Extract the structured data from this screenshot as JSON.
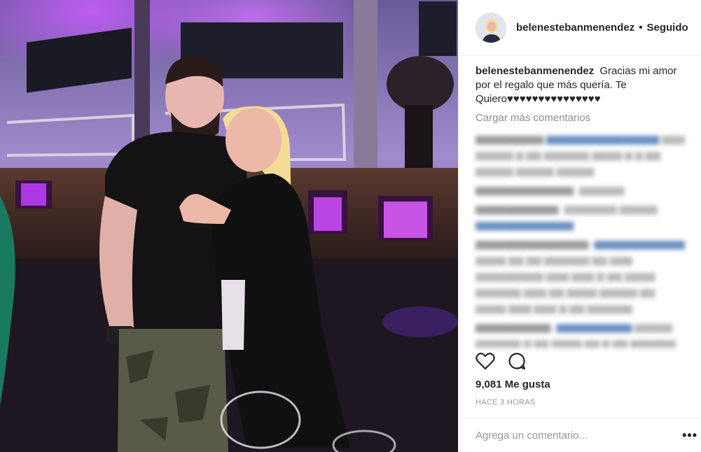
{
  "header": {
    "username": "belenestebanmenendez",
    "separator": "•",
    "follow_status": "Seguido"
  },
  "caption": {
    "username": "belenestebanmenendez",
    "text": "Gracias mi amor por el regalo que más quería. Te Quiero♥♥♥♥♥♥♥♥♥♥♥♥♥♥♥"
  },
  "comments": {
    "load_more": "Cargar más comentarios"
  },
  "actions": {
    "like_icon": "heart-icon",
    "comment_icon": "comment-icon"
  },
  "stats": {
    "likes": "9,081 Me gusta",
    "time": "HACE 3 HORAS"
  },
  "add_comment": {
    "placeholder": "Agrega un comentario...",
    "more_label": "•••"
  },
  "colors": {
    "text": "#262626",
    "muted": "#8e8e8e",
    "border": "#efefef",
    "neon_purple": "#b43cff"
  }
}
